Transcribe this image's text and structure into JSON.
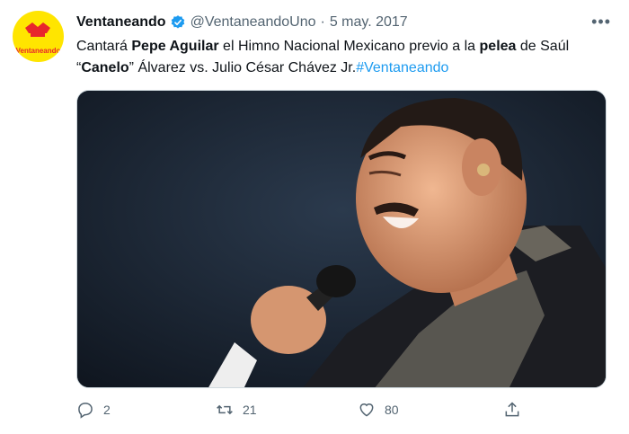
{
  "tweet": {
    "author_name": "Ventaneando",
    "handle": "@VentaneandoUno",
    "separator": "·",
    "date": "5 may. 2017",
    "more_label": "•••",
    "text_parts": [
      "Cantará ",
      "Pepe Aguilar",
      " el Himno Nacional Mexicano previo a la ",
      "pelea",
      " de Saúl “",
      "Canelo",
      "” Álvarez  vs. Julio César Chávez Jr.",
      "#Ventaneando"
    ],
    "avatar_logo_text": "Ventaneando"
  },
  "actions": {
    "reply_count": "2",
    "retweet_count": "21",
    "like_count": "80"
  },
  "colors": {
    "accent": "#1d9bf0",
    "muted": "#536471",
    "avatar_bg": "#ffe500"
  }
}
